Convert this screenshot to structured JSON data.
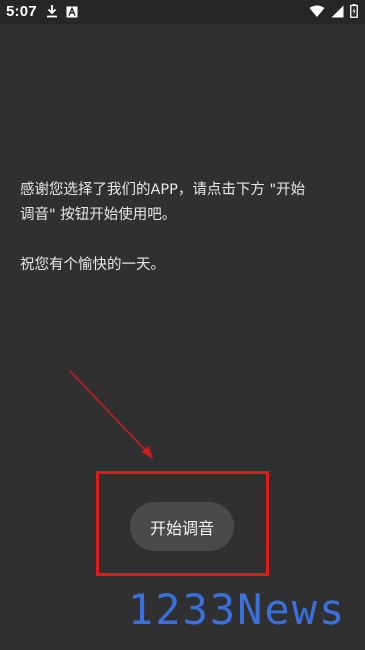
{
  "status_bar": {
    "time": "5:07",
    "icons_left": [
      "download-icon",
      "app-a-icon"
    ],
    "icons_right": [
      "wifi-icon",
      "signal-icon",
      "battery-icon"
    ]
  },
  "message": {
    "line1": "感谢您选择了我们的APP，请点击下方 \"开始",
    "line2": "调音\" 按钮开始使用吧。",
    "line3": "祝您有个愉快的一天。"
  },
  "start_button": {
    "label": "开始调音"
  },
  "watermark": {
    "text": "1233News"
  },
  "colors": {
    "background": "#303030",
    "highlight_box": "#e01b1b",
    "arrow": "#c81d1d",
    "button": "#4a4a4a",
    "watermark": "#3b74e6"
  }
}
